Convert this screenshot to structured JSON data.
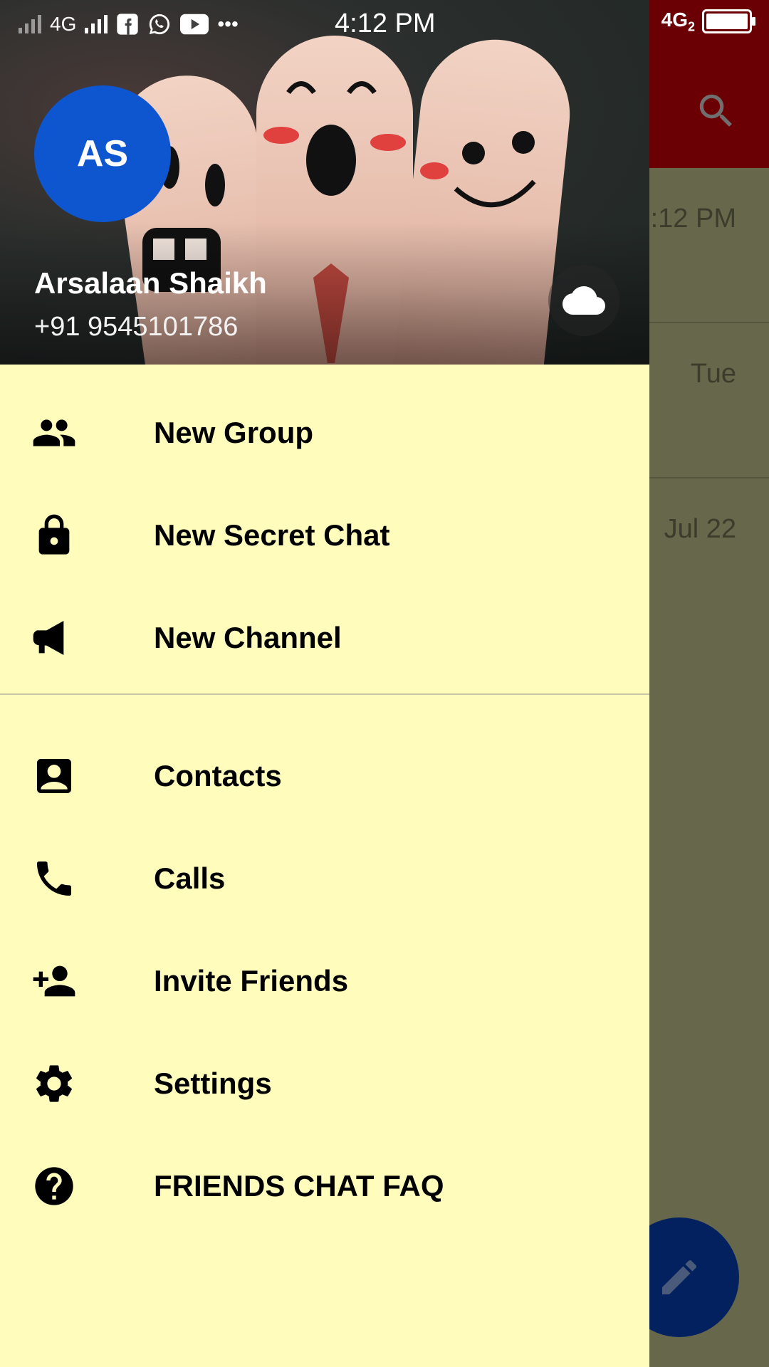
{
  "status_bar": {
    "network_left": "4G",
    "time": "4:12 PM",
    "network_right": "4G",
    "network_right_sub": "2",
    "app_icons": [
      "facebook-icon",
      "whatsapp-icon",
      "youtube-icon",
      "more-dots-icon"
    ]
  },
  "background": {
    "rows": [
      {
        "time": ":12 PM"
      },
      {
        "time": "Tue"
      },
      {
        "time": "Jul 22"
      }
    ]
  },
  "drawer": {
    "avatar_initials": "AS",
    "user_name": "Arsalaan Shaikh",
    "user_phone": "+91 9545101786",
    "menu_primary": [
      {
        "label": "New Group",
        "icon": "group-icon"
      },
      {
        "label": "New Secret Chat",
        "icon": "lock-icon"
      },
      {
        "label": "New Channel",
        "icon": "megaphone-icon"
      }
    ],
    "menu_secondary": [
      {
        "label": "Contacts",
        "icon": "contact-icon"
      },
      {
        "label": "Calls",
        "icon": "phone-icon"
      },
      {
        "label": "Invite Friends",
        "icon": "add-person-icon"
      },
      {
        "label": "Settings",
        "icon": "gear-icon"
      },
      {
        "label": "FRIENDS CHAT FAQ",
        "icon": "help-icon"
      }
    ]
  },
  "colors": {
    "drawer_bg": "#fffcbc",
    "avatar_bg": "#0e56d0",
    "toolbar_dimmed": "#6b0004",
    "fab_dimmed": "#03215e"
  }
}
